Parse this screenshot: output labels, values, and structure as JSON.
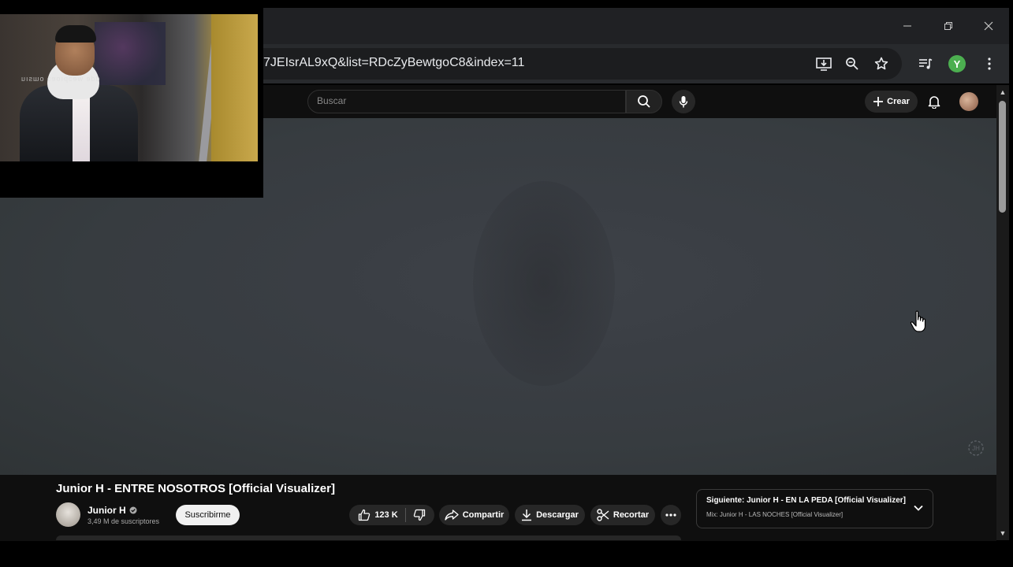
{
  "browser": {
    "url_visible": "7JEIsrAL9xQ&list=RDcZyBewtgoC8&index=11",
    "profile_initial": "Y",
    "profile_color": "#4caf50"
  },
  "masthead": {
    "search_placeholder": "Buscar",
    "create_label": "Crear"
  },
  "video": {
    "title": "Junior H - ENTRE NOSOTROS [Official Visualizer]"
  },
  "channel": {
    "name": "Junior H",
    "subscribers": "3,49 M de suscriptores",
    "subscribe_label": "Suscribirme"
  },
  "actions": {
    "likes": "123 K",
    "share_label": "Compartir",
    "download_label": "Descargar",
    "clip_label": "Recortar"
  },
  "up_next": {
    "title": "Siguiente: Junior H - EN LA PEDA [Official Visualizer]",
    "subtitle": "Mix: Junior H - LAS NOCHES [Official Visualizer]"
  },
  "webcam": {
    "watermark": "dde weɔpıoɐɔ oɯsıu"
  }
}
